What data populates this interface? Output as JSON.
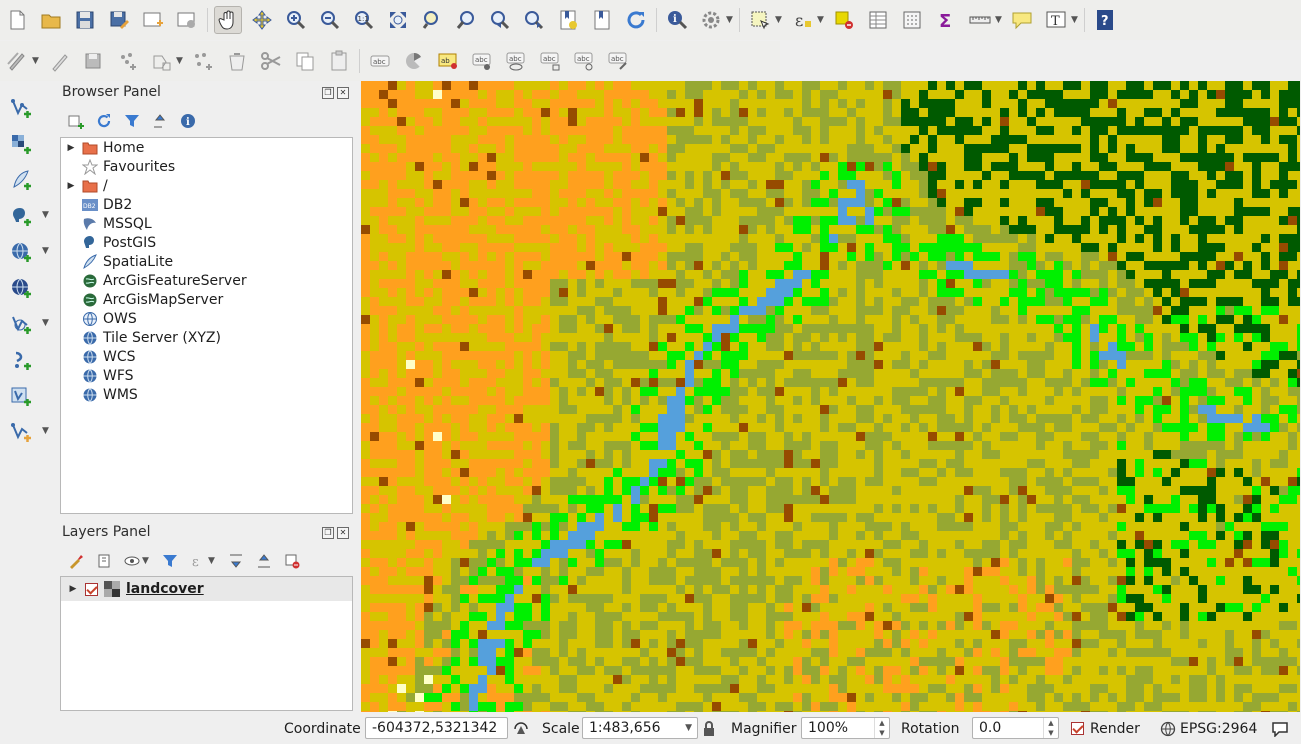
{
  "colors": {
    "accent": "#c8432b",
    "map_yellow": "#d6c400",
    "map_olive": "#96a832",
    "map_orange": "#ffa01e",
    "map_darkgreen": "#005a00",
    "map_green": "#00f000",
    "map_water": "#55a0dc",
    "map_brown": "#964b00",
    "map_pale": "#ffffc8"
  },
  "toolbar_main": [
    "new-project-icon",
    "open-project-icon",
    "save-project-icon",
    "save-as-icon",
    "new-print-layout-icon",
    "layout-manager-icon",
    "pan-icon",
    "pan-to-selection-icon",
    "zoom-in-icon",
    "zoom-out-icon",
    "zoom-native-icon",
    "zoom-full-icon",
    "zoom-to-selection-icon",
    "zoom-to-layer-icon",
    "zoom-last-icon",
    "zoom-next-icon",
    "new-bookmark-icon",
    "show-bookmarks-icon",
    "refresh-icon",
    "identify-icon",
    "run-action-icon",
    "select-features-icon",
    "select-by-expression-icon",
    "deselect-icon",
    "attribute-table-icon",
    "field-calculator-icon",
    "statistics-icon",
    "measure-icon",
    "map-tips-icon",
    "text-annotation-icon",
    "help-icon"
  ],
  "toolbar_digitize": [
    "current-edits-icon",
    "toggle-editing-icon",
    "save-edits-icon",
    "add-feature-icon",
    "move-feature-icon",
    "vertex-tool-icon",
    "delete-selected-icon",
    "cut-features-icon",
    "copy-features-icon",
    "paste-features-icon",
    "label-icon",
    "diagram-icon",
    "layer-labeling-icon",
    "pin-labels-icon",
    "show-hide-labels-icon",
    "move-label-icon",
    "rotate-label-icon",
    "change-label-icon"
  ],
  "left_toolbar": [
    "add-vector-layer-icon",
    "add-raster-layer-icon",
    "add-spatialite-layer-icon",
    "add-postgis-layer-icon",
    "add-wms-layer-icon",
    "add-wcs-layer-icon",
    "add-wfs-layer-icon",
    "add-delimited-text-icon",
    "add-virtual-layer-icon",
    "new-shapefile-icon"
  ],
  "browser": {
    "title": "Browser Panel",
    "items": [
      {
        "label": "Home",
        "icon": "folder-icon",
        "expandable": true
      },
      {
        "label": "Favourites",
        "icon": "star-icon",
        "expandable": false
      },
      {
        "label": "/",
        "icon": "folder-icon",
        "expandable": true
      },
      {
        "label": "DB2",
        "icon": "db2-icon",
        "expandable": false
      },
      {
        "label": "MSSQL",
        "icon": "mssql-icon",
        "expandable": false
      },
      {
        "label": "PostGIS",
        "icon": "postgis-icon",
        "expandable": false
      },
      {
        "label": "SpatiaLite",
        "icon": "spatialite-icon",
        "expandable": false
      },
      {
        "label": "ArcGisFeatureServer",
        "icon": "arcgis-icon",
        "expandable": false
      },
      {
        "label": "ArcGisMapServer",
        "icon": "arcgis-icon",
        "expandable": false
      },
      {
        "label": "OWS",
        "icon": "ows-icon",
        "expandable": false
      },
      {
        "label": "Tile Server (XYZ)",
        "icon": "globe-icon",
        "expandable": false
      },
      {
        "label": "WCS",
        "icon": "globe-icon",
        "expandable": false
      },
      {
        "label": "WFS",
        "icon": "globe-icon",
        "expandable": false
      },
      {
        "label": "WMS",
        "icon": "globe-icon",
        "expandable": false
      }
    ]
  },
  "layers": {
    "title": "Layers Panel",
    "items": [
      {
        "label": "landcover",
        "checked": true
      }
    ]
  },
  "status": {
    "coordinate_label": "Coordinate",
    "coordinate_value": "-604372,5321342",
    "scale_label": "Scale",
    "scale_value": "1:483,656",
    "magnifier_label": "Magnifier",
    "magnifier_value": "100%",
    "rotation_label": "Rotation",
    "rotation_value": "0.0",
    "render_label": "Render",
    "crs_label": "EPSG:2964"
  }
}
